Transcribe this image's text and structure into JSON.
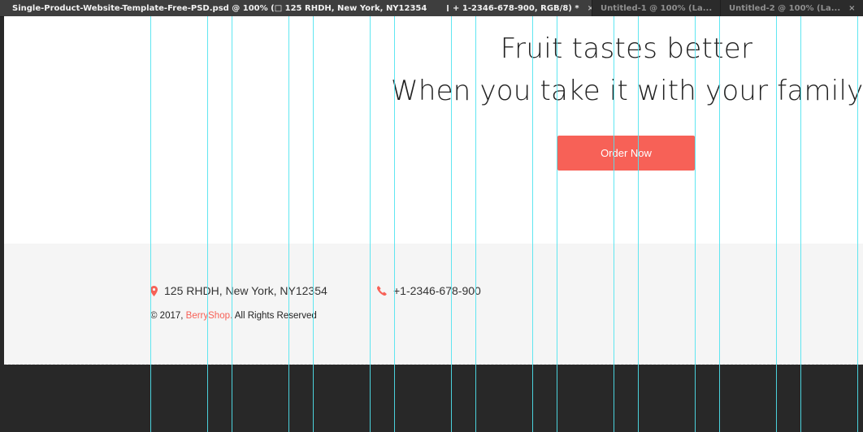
{
  "tabs": [
    {
      "label": "Single-Product-Website-Template-Free-PSD.psd  @  100%  (□ 125 RHDH,  New  York,  NY12354",
      "active": true,
      "close": "□"
    },
    {
      "label": "+ 1-2346-678-900, RGB/8) *",
      "active": true,
      "close": "×"
    },
    {
      "label": "Untitled-1 @ 100% (La...",
      "active": false,
      "close": "×"
    },
    {
      "label": "Untitled-2 @ 100% (La...",
      "active": false,
      "close": "×"
    }
  ],
  "hero": {
    "line1": "Fruit tastes better",
    "line2": "When you take it with your family",
    "button": "Order Now"
  },
  "footer": {
    "address": "125 RHDH, New York, NY12354",
    "address_icon": "map-marker-icon",
    "phone": "+1-2346-678-900",
    "phone_icon": "phone-icon",
    "copyright_prefix": "© 2017, ",
    "brand": "BerryShop.",
    "copyright_suffix": " All Rights Reserved"
  },
  "colors": {
    "accent": "#f76157",
    "guide": "#4fe3ef",
    "workspace": "#282828",
    "footer_bg": "#f5f5f5"
  }
}
